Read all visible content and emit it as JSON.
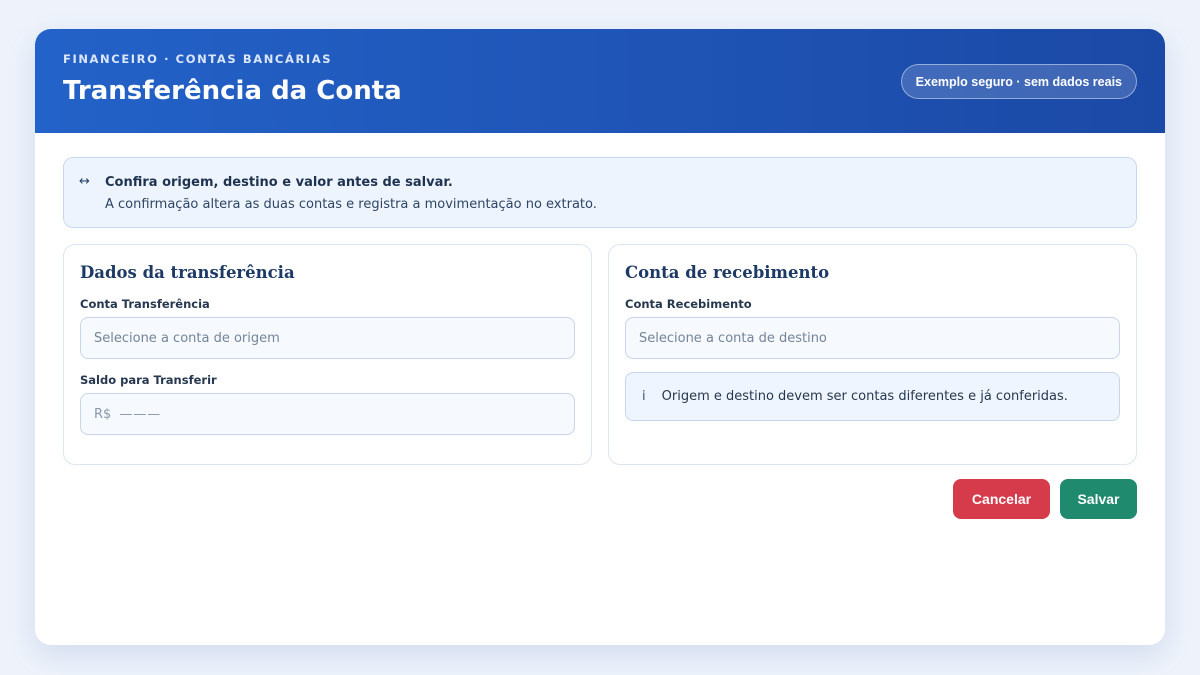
{
  "header": {
    "eyebrow": "FINANCEIRO · CONTAS BANCÁRIAS",
    "title": "Transferência da Conta",
    "badge": "Exemplo seguro · sem dados reais"
  },
  "notice": {
    "icon": "↔",
    "icon_name": "transfer-arrows-icon",
    "title": "Confira origem, destino e valor antes de salvar.",
    "text": "A confirmação altera as duas contas e registra a movimentação no extrato."
  },
  "transfer_card": {
    "title": "Dados da transferência",
    "account_label": "Conta Transferência",
    "account_placeholder": "Selecione a conta de origem",
    "amount_label": "Saldo para Transferir",
    "amount_prefix": "R$",
    "amount_value": "———"
  },
  "receive_card": {
    "title": "Conta de recebimento",
    "account_label": "Conta Recebimento",
    "account_placeholder": "Selecione a conta de destino",
    "hint_icon": "i",
    "hint_icon_name": "info-icon",
    "hint_text": "Origem e destino devem ser contas diferentes e já conferidas."
  },
  "actions": {
    "cancel_label": "Cancelar",
    "save_label": "Salvar"
  },
  "colors": {
    "header_blue": "#2362c8",
    "cancel_red": "#d63b4c",
    "save_green": "#1f8a6d"
  }
}
